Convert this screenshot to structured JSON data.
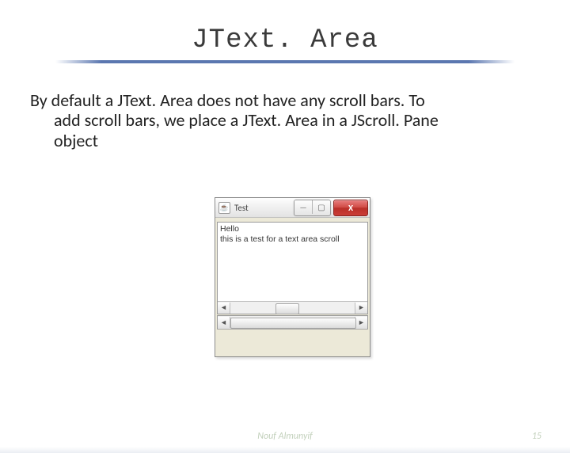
{
  "title": "JText. Area",
  "body": {
    "line1": "By default a JText. Area does not have any scroll bars. To",
    "line2": "add scroll bars, we place a JText. Area in a JScroll. Pane",
    "line3": "object"
  },
  "window": {
    "title": "Test",
    "text_line1": "Hello",
    "text_line2": "this is a test for a text area scroll",
    "close_glyph": "X",
    "min_glyph": "—",
    "max_glyph": "▢",
    "left_arrow": "◄",
    "right_arrow": "►"
  },
  "footer": {
    "author": "Nouf Almunyif",
    "page": "15"
  }
}
